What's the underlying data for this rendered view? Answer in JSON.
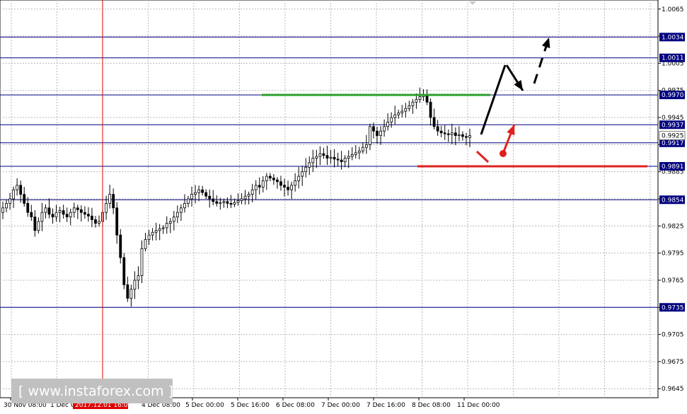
{
  "chart_data": {
    "type": "candlestick",
    "title": "",
    "xlabel": "",
    "ylabel": "",
    "ylim": [
      0.9635,
      1.0075
    ],
    "y_ticks": [
      1.0065,
      1.0035,
      1.0005,
      0.9975,
      0.9945,
      0.9915,
      0.9885,
      0.9855,
      0.9825,
      0.9795,
      0.9765,
      0.9735,
      0.9705,
      0.9675,
      0.9645
    ],
    "y_tick_labels": [
      "1.0065",
      "",
      "1.0005",
      "0.9975",
      "0.9945",
      "",
      "0.9885",
      "",
      "0.9825",
      "0.9795",
      "0.9765",
      "",
      "0.9705",
      "0.9675",
      "0.9645"
    ],
    "x_tick_labels": [
      "30 Nov 08:00",
      "1 Dec 0",
      "4 Dec 08:00",
      "5 Dec 00:00",
      "5 Dec 16:00",
      "6 Dec 08:00",
      "7 Dec 00:00",
      "7 Dec 16:00",
      "8 Dec 08:00",
      "11 Dec 00:00"
    ],
    "cursor_label": "2017.12.01 16:00",
    "grid": true,
    "current_price": "0.9925",
    "levels": [
      {
        "price": 1.0034,
        "label": "1.0034"
      },
      {
        "price": 1.0011,
        "label": "1.0011"
      },
      {
        "price": 0.997,
        "label": "0.9970"
      },
      {
        "price": 0.9937,
        "label": "0.9937"
      },
      {
        "price": 0.9917,
        "label": "0.9917"
      },
      {
        "price": 0.9891,
        "label": "0.9891"
      },
      {
        "price": 0.9854,
        "label": "0.9854"
      },
      {
        "price": 0.9735,
        "label": "0.9735"
      }
    ],
    "candle_close_path": [
      0.9845,
      0.985,
      0.9855,
      0.9865,
      0.987,
      0.986,
      0.985,
      0.984,
      0.9835,
      0.982,
      0.983,
      0.984,
      0.9845,
      0.9838,
      0.9835,
      0.984,
      0.9842,
      0.9838,
      0.9835,
      0.984,
      0.9845,
      0.9843,
      0.984,
      0.9838,
      0.9836,
      0.9832,
      0.9828,
      0.983,
      0.984,
      0.985,
      0.986,
      0.9845,
      0.9815,
      0.979,
      0.976,
      0.9745,
      0.9755,
      0.9765,
      0.977,
      0.98,
      0.981,
      0.9815,
      0.9818,
      0.982,
      0.9822,
      0.9823,
      0.9828,
      0.983,
      0.9835,
      0.984,
      0.9845,
      0.985,
      0.9855,
      0.986,
      0.9862,
      0.9865,
      0.9862,
      0.9858,
      0.9855,
      0.9852,
      0.985,
      0.9851,
      0.9852,
      0.985,
      0.9849,
      0.9851,
      0.9853,
      0.9855,
      0.9858,
      0.986,
      0.9865,
      0.987,
      0.9868,
      0.9875,
      0.988,
      0.9878,
      0.9876,
      0.9874,
      0.987,
      0.9868,
      0.9865,
      0.987,
      0.9875,
      0.988,
      0.9885,
      0.989,
      0.9895,
      0.99,
      0.9902,
      0.9905,
      0.9903,
      0.99,
      0.9901,
      0.9899,
      0.9898,
      0.9896,
      0.99,
      0.9902,
      0.9904,
      0.9906,
      0.9908,
      0.9912,
      0.9915,
      0.9935,
      0.993,
      0.9925,
      0.993,
      0.9935,
      0.994,
      0.9945,
      0.9948,
      0.995,
      0.9952,
      0.9955,
      0.9958,
      0.9962,
      0.9965,
      0.9968,
      0.997,
      0.9962,
      0.9945,
      0.9935,
      0.993,
      0.9928,
      0.9927,
      0.9926,
      0.9928,
      0.9925,
      0.9926,
      0.9924,
      0.9923,
      0.9925
    ],
    "annotations": {
      "green_resistance_price": 0.997,
      "red_support_price": 0.9891
    }
  }
}
